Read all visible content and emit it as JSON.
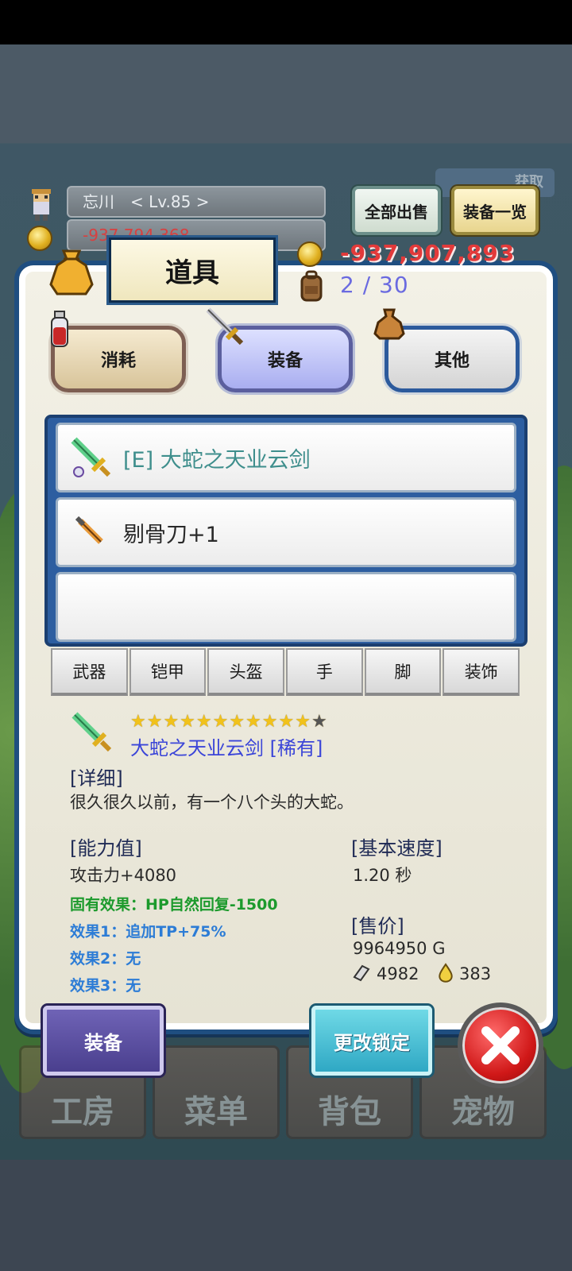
{
  "player": {
    "name_level": "忘川　< Lv.85 >",
    "money_partial": "-937,794,368"
  },
  "top_buttons": {
    "sell_all": "全部出售",
    "equip_list": "装备一览",
    "ribbon": "获取"
  },
  "panel": {
    "title": "道具",
    "gold": "-937,907,893",
    "capacity": "2 / 30"
  },
  "categories": {
    "consume": "消耗",
    "equip": "装备",
    "other": "其他"
  },
  "items": [
    {
      "label": "[E] 大蛇之天业云剑",
      "icon": "green-sword-icon"
    },
    {
      "label": "剔骨刀+1",
      "icon": "knife-icon"
    },
    {
      "label": "",
      "icon": ""
    }
  ],
  "slot_tabs": [
    "武器",
    "铠甲",
    "头盔",
    "手",
    "脚",
    "装饰"
  ],
  "detail": {
    "stars": "★★★★★★★★★★★",
    "star_empty": "★",
    "name": "大蛇之天业云剑 [稀有]",
    "detail_heading": "[详细]",
    "description": "很久很久以前，有一个八个头的大蛇。",
    "ability_heading": "[能力值]",
    "attack": "攻击力+4080",
    "inherent": "固有效果：HP自然回复-1500",
    "effect1": "效果1：追加TP+75%",
    "effect2": "效果2：无",
    "effect3": "效果3：无",
    "speed_heading": "[基本速度]",
    "speed": "1.20 秒",
    "price_heading": "[售价]",
    "price": "9964950 G",
    "material1": "4982",
    "material2": "383"
  },
  "actions": {
    "equip": "装备",
    "change_lock": "更改锁定"
  },
  "bottom_nav": [
    "工房",
    "菜单",
    "背包",
    "宠物"
  ],
  "colors": {
    "panel_border": "#1f4e80",
    "gold_text": "#e23a3a",
    "item_name": "#3b45d8"
  }
}
